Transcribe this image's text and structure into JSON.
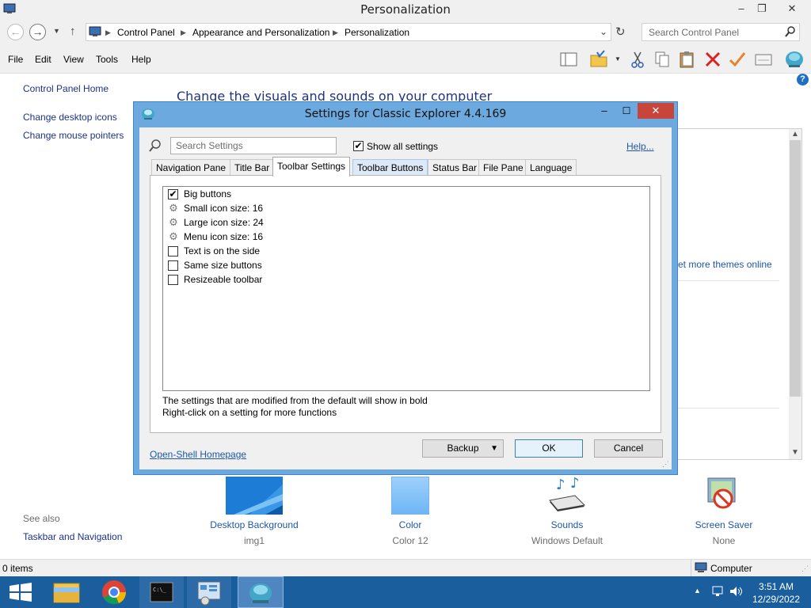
{
  "window": {
    "title": "Personalization",
    "minimize": "–",
    "maximize": "❐",
    "close": "✕"
  },
  "address": {
    "crumbs": [
      "Control Panel",
      "Appearance and Personalization",
      "Personalization"
    ],
    "search_placeholder": "Search Control Panel"
  },
  "menubar": {
    "items": [
      "File",
      "Edit",
      "View",
      "Tools",
      "Help"
    ]
  },
  "sidebar": {
    "home": "Control Panel Home",
    "links": [
      "Change desktop icons",
      "Change mouse pointers"
    ],
    "see_also_title": "See also",
    "see_also_links": [
      "Taskbar and Navigation"
    ]
  },
  "main": {
    "heading": "Change the visuals and sounds on your computer",
    "themes_link": "et more themes online",
    "items": [
      {
        "label": "Desktop Background",
        "value": "img1",
        "icon": "desktop-background-icon"
      },
      {
        "label": "Color",
        "value": "Color 12",
        "icon": "color-swatch-icon"
      },
      {
        "label": "Sounds",
        "value": "Windows Default",
        "icon": "sounds-icon"
      },
      {
        "label": "Screen Saver",
        "value": "None",
        "icon": "screen-saver-icon"
      }
    ]
  },
  "statusbar": {
    "items_count": "0 items",
    "location": "Computer"
  },
  "taskbar": {
    "time": "3:51 AM",
    "date": "12/29/2022"
  },
  "dialog": {
    "title": "Settings for Classic Explorer 4.4.169",
    "search_placeholder": "Search Settings",
    "show_all_label": "Show all settings",
    "show_all_checked": true,
    "help_link": "Help...",
    "tabs": [
      "Navigation Pane",
      "Title Bar",
      "Toolbar Settings",
      "Toolbar Buttons",
      "Status Bar",
      "File Pane",
      "Language"
    ],
    "active_tab": "Toolbar Settings",
    "settings": [
      {
        "label": "Big buttons",
        "kind": "checkbox",
        "checked": true
      },
      {
        "label": "Small icon size: 16",
        "kind": "value"
      },
      {
        "label": "Large icon size: 24",
        "kind": "value"
      },
      {
        "label": "Menu icon size: 16",
        "kind": "value"
      },
      {
        "label": "Text is on the side",
        "kind": "checkbox",
        "checked": false
      },
      {
        "label": "Same size buttons",
        "kind": "checkbox",
        "checked": false
      },
      {
        "label": "Resizeable toolbar",
        "kind": "checkbox",
        "checked": false
      }
    ],
    "hint_line1": "The settings that are modified from the default will show in bold",
    "hint_line2": "Right-click on a setting for more functions",
    "homepage_link": "Open-Shell Homepage",
    "backup_label": "Backup",
    "ok_label": "OK",
    "cancel_label": "Cancel"
  }
}
